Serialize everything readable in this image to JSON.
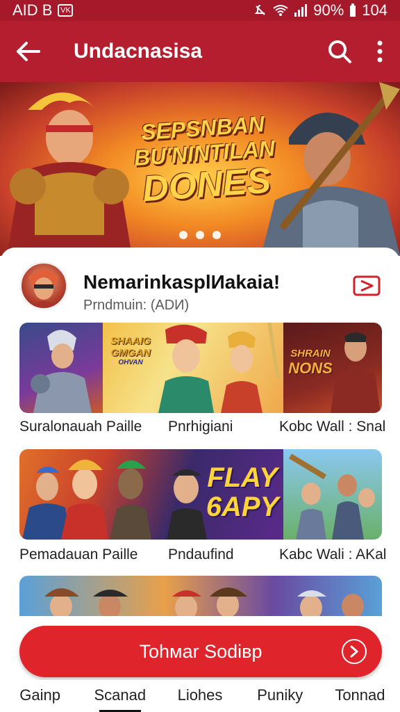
{
  "status_bar": {
    "left_text": "AID B",
    "badge": "ⓥ",
    "battery": "90%",
    "time": "104"
  },
  "app_bar": {
    "title": "Undacnasisa",
    "back_icon": "back-arrow-icon",
    "search_icon": "search-icon",
    "menu_icon": "more-vert-icon"
  },
  "hero": {
    "line1": "SEPSNBAN",
    "line2": "BU'NINTILAN",
    "line3": "DONES",
    "dots": 3
  },
  "profile": {
    "name": "NemarinkasplИakaia!",
    "subtitle": "Prndmuin: (ADИ)",
    "action_icon": "play-icon"
  },
  "rows": [
    {
      "tile_texts": [
        "SHAAIG",
        "GMGAN",
        "OHVAN",
        "SHRAIN",
        "NONS"
      ],
      "labels": [
        "Suralonauah Paille",
        "Pnrhigiani",
        "Kobc Wall : Snal"
      ]
    },
    {
      "tile_texts": [
        "FLAY",
        "6APY"
      ],
      "labels": [
        "Pemadauan Paille",
        "Pndaufind",
        "Kabc Wali : AKal"
      ]
    }
  ],
  "cta": {
    "label": "Tohмar Sodiвр"
  },
  "bottom_nav": {
    "items": [
      "Gainp",
      "Scanad",
      "Liohes",
      "Puniky",
      "Tonnad"
    ],
    "active": 1
  },
  "colors": {
    "brand": "#b51e2e",
    "cta": "#e0242b"
  }
}
